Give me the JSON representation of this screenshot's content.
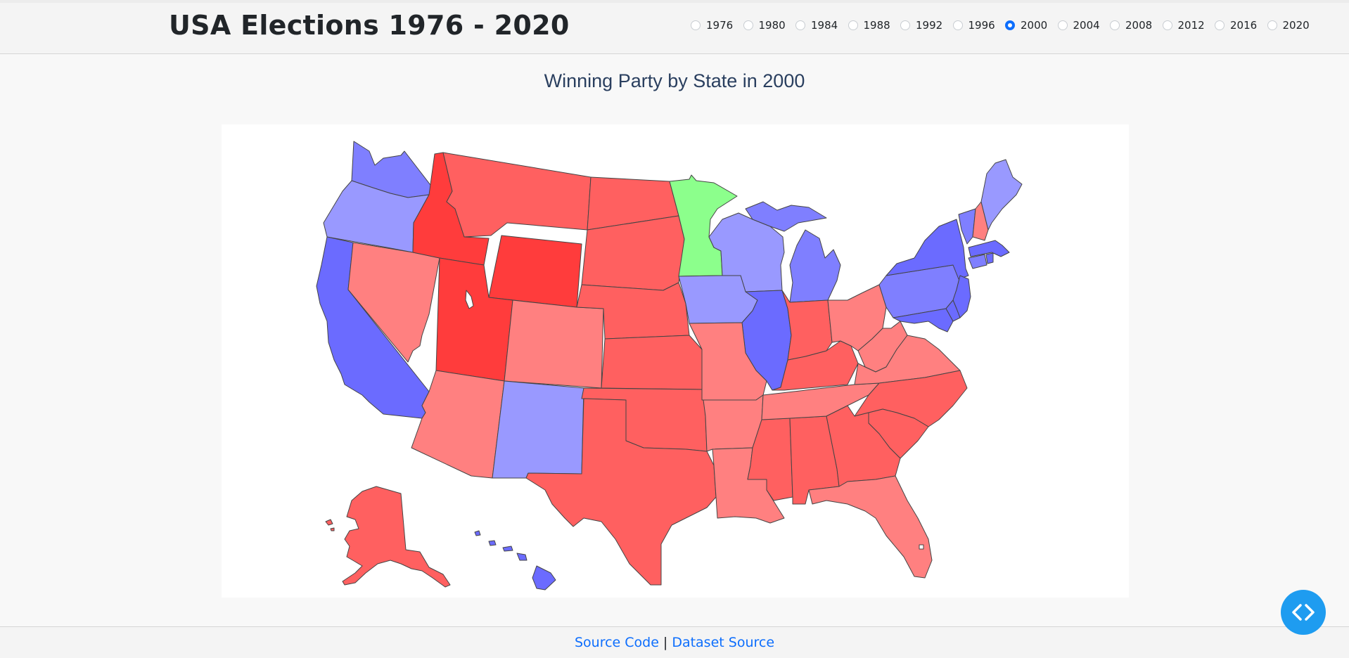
{
  "header": {
    "title": "USA Elections 1976 - 2020",
    "years": [
      "1976",
      "1980",
      "1984",
      "1988",
      "1992",
      "1996",
      "2000",
      "2004",
      "2008",
      "2012",
      "2016",
      "2020"
    ],
    "selected_year": "2000"
  },
  "main": {
    "map_title": "Winning Party by State in 2000"
  },
  "footer": {
    "source_code": "Source Code",
    "separator": "|",
    "dataset_source": "Dataset Source"
  },
  "colors": {
    "dem_strong": "#6b6bff",
    "dem_medium": "#7f7fff",
    "dem_light": "#9999ff",
    "rep_strong": "#ff3c3c",
    "rep_medium": "#ff6060",
    "rep_light": "#ff8080",
    "other": "#8cff8c",
    "radio_checked": "#0d6efd",
    "fab": "#1e9cf0"
  },
  "icons": {
    "fab": "code-brackets-icon"
  }
}
